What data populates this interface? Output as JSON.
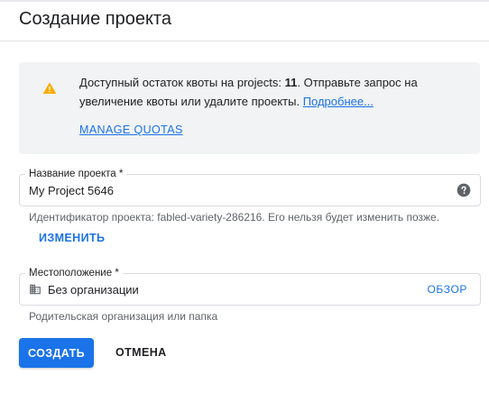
{
  "dialog": {
    "title": "Создание проекта"
  },
  "quota_notice": {
    "text_before": "Доступный остаток квоты на projects: ",
    "count": "11",
    "text_after": ". Отправьте запрос на увеличение квоты или удалите проекты. ",
    "learn_more_link": "Подробнее...",
    "manage_quotas_link": "MANAGE QUOTAS",
    "icon": "warning-icon"
  },
  "project_name": {
    "label": "Название проекта *",
    "value": "My Project 5646",
    "help_icon": "help-icon"
  },
  "project_id": {
    "hint": "Идентификатор проекта: fabled-variety-286216. Его нельзя будет изменить позже.",
    "edit_button": "ИЗМЕНИТЬ"
  },
  "location": {
    "label": "Местоположение *",
    "value": "Без организации",
    "browse_button": "ОБЗОР",
    "icon": "organization-icon",
    "hint": "Родительская организация или папка"
  },
  "actions": {
    "create_label": "СОЗДАТЬ",
    "cancel_label": "ОТМЕНА"
  },
  "colors": {
    "accent": "#1a73e8",
    "warning": "#f9ab00",
    "notice_bg": "#f1f3f4"
  }
}
